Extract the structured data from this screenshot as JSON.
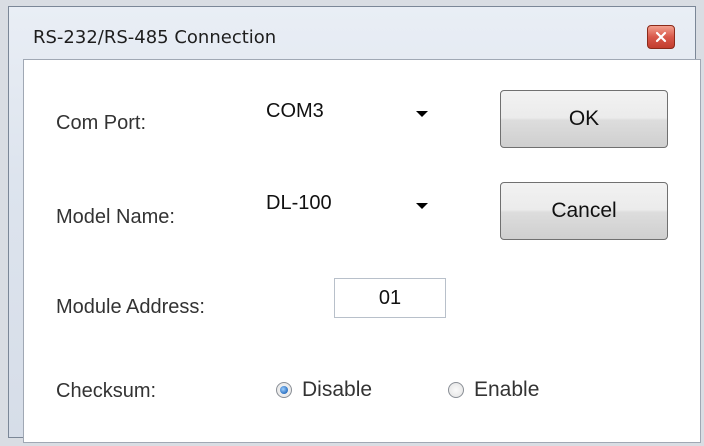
{
  "window": {
    "title": "RS-232/RS-485 Connection"
  },
  "form": {
    "com_port_label": "Com Port:",
    "com_port_value": "COM3",
    "model_name_label": "Model Name:",
    "model_name_value": "DL-100",
    "module_address_label": "Module Address:",
    "module_address_value": "01",
    "checksum_label": "Checksum:",
    "checksum_options": [
      {
        "label": "Disable",
        "selected": true
      },
      {
        "label": "Enable",
        "selected": false
      }
    ]
  },
  "buttons": {
    "ok_label": "OK",
    "cancel_label": "Cancel"
  },
  "colors": {
    "close_button": "#d04a3b",
    "radio_selected": "#2b6fc0"
  },
  "icons": {
    "close": "close-icon",
    "dropdown": "chevron-down-icon"
  }
}
